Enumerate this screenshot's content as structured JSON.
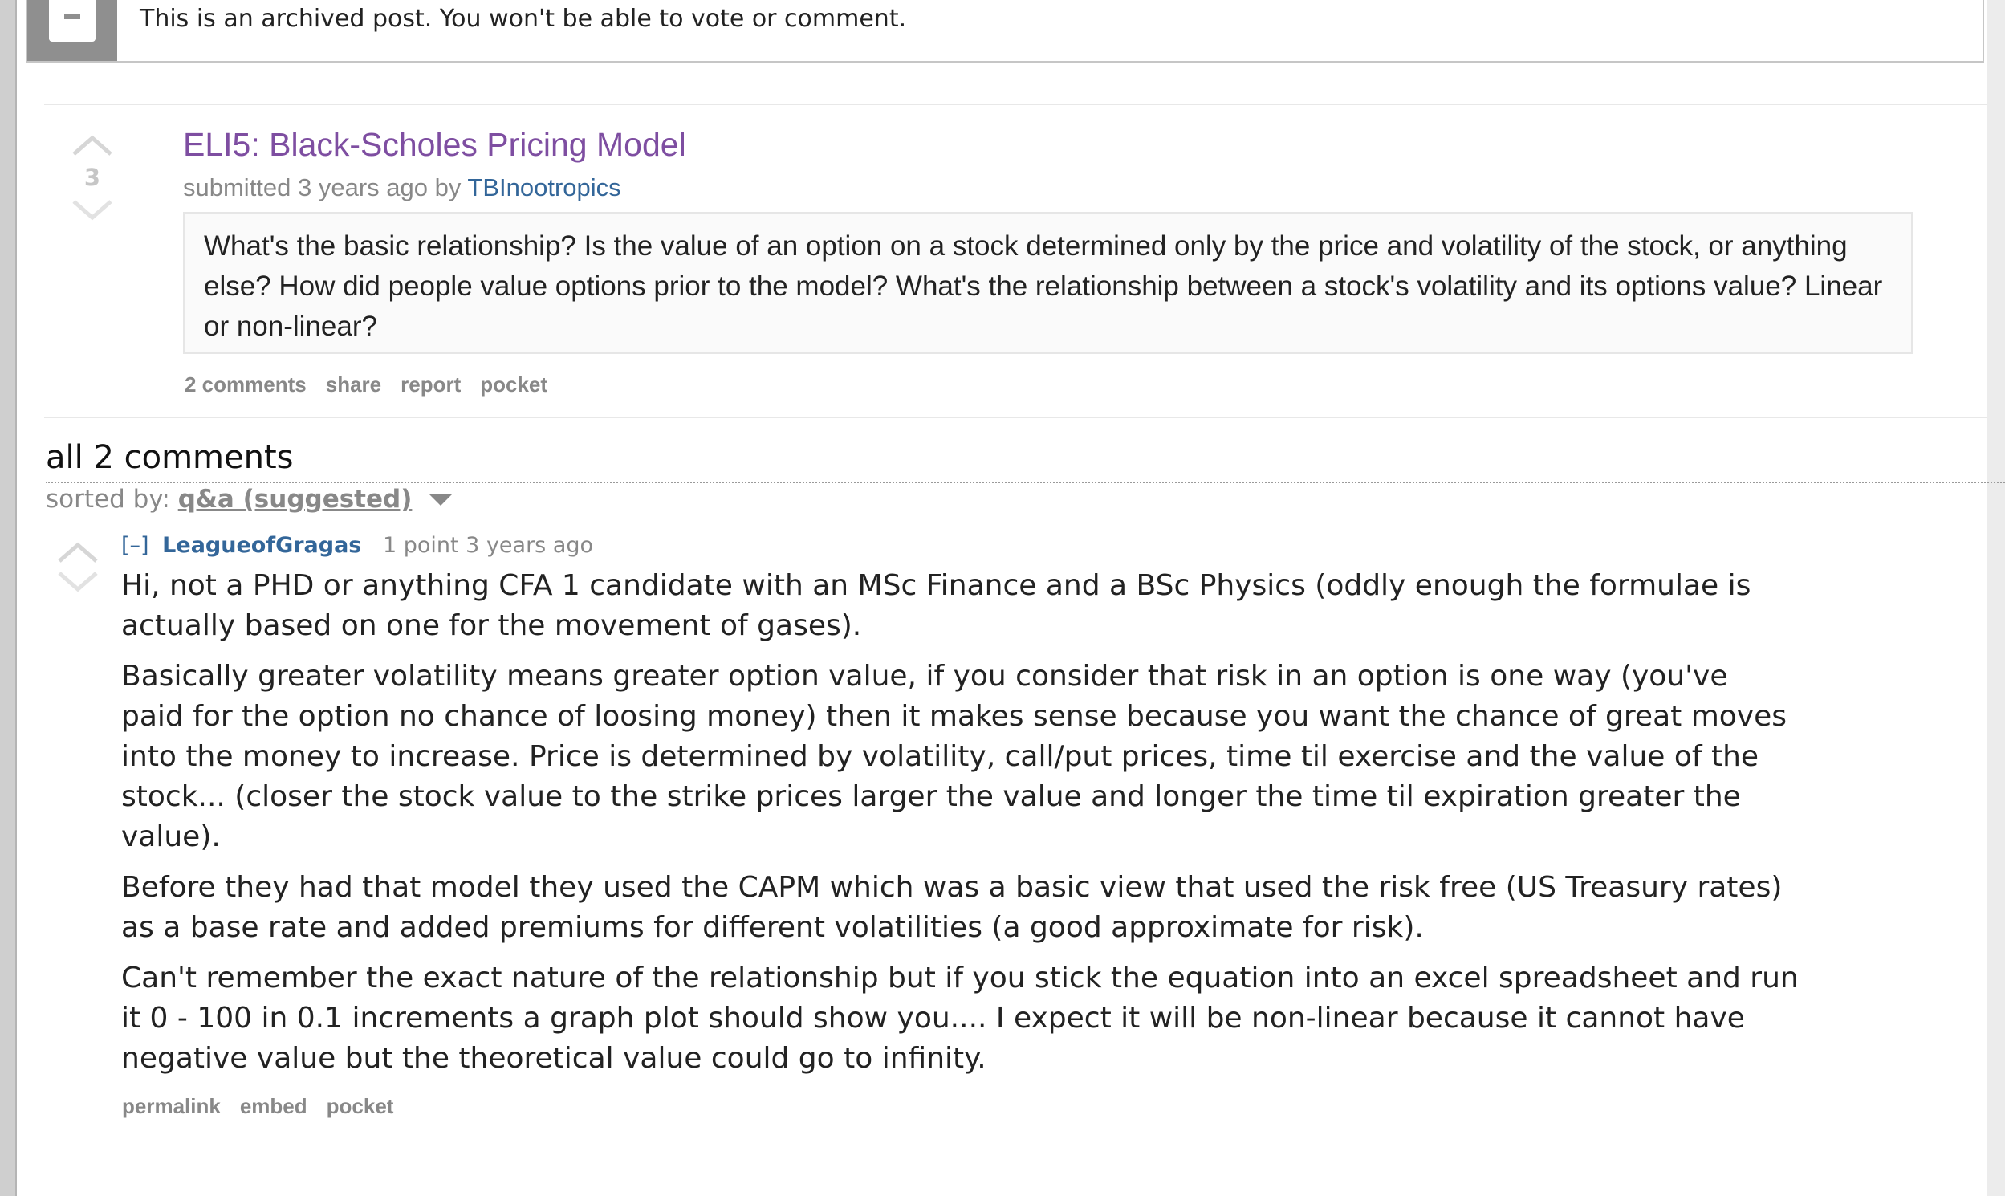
{
  "banner": {
    "text": "This is an archived post. You won't be able to vote or comment.",
    "icon": "archive-box-icon"
  },
  "post": {
    "score": "3",
    "title": "ELI5: Black-Scholes Pricing Model",
    "submitted_prefix": "submitted 3 years ago by",
    "author": "TBInootropics",
    "selftext": "What's the basic relationship? Is the value of an option on a stock determined only by the price and volatility of the stock, or anything else? How did people value options prior to the model? What's the relationship between a stock's volatility and its options value? Linear or non-linear?",
    "buttons": {
      "comments": "2 comments",
      "share": "share",
      "report": "report",
      "pocket": "pocket"
    }
  },
  "comments_area": {
    "heading": "all 2 comments",
    "sorted_label": "sorted by:",
    "sorted_value": "q&a (suggested)"
  },
  "comment": {
    "expand": "[–]",
    "author": "LeagueofGragas",
    "meta": "1 point 3 years ago",
    "lines": [
      [
        "Hi, not a PHD or anything CFA 1 candidate with an MSc Finance and a BSc Physics (oddly enough the formulae is",
        "actually based on one for the movement of gases)."
      ],
      [
        "Basically greater volatility means greater option value, if you consider that risk in an option is one way (you've",
        "paid for the option no chance of loosing money) then it makes sense because you want the chance of great moves",
        "into the money to increase. Price is determined by volatility, call/put prices, time til exercise and the value of the",
        "stock... (closer the stock value to the strike prices larger the value and longer the time til expiration greater the",
        "value)."
      ],
      [
        "Before they had that model they used the CAPM which was a basic view that used the risk free (US Treasury rates)",
        "as a base rate and added premiums for different volatilities (a good approximate for risk)."
      ],
      [
        "Can't remember the exact nature of the relationship but if you stick the equation into an excel spreadsheet and run",
        "it 0 - 100 in 0.1 increments a graph plot should show you.... I expect it will be non-linear because it cannot have",
        "negative value but the theoretical value could go to infinity."
      ]
    ],
    "buttons": {
      "permalink": "permalink",
      "embed": "embed",
      "pocket": "pocket"
    }
  }
}
